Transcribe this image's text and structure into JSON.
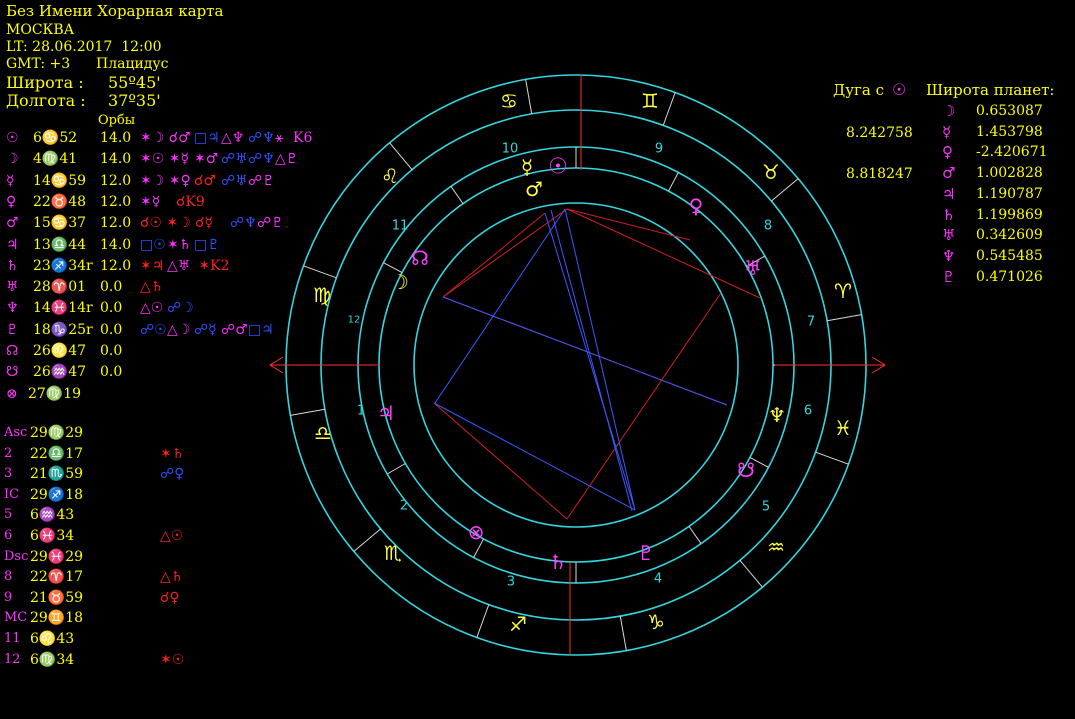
{
  "header": {
    "title": "Без Имени Хорарная карта",
    "city": "МОСКВА",
    "lt": "LT: 28.06.2017  12:00",
    "gmt": "GMT: +3",
    "system": "Плацидус",
    "lat_label": "Широта :",
    "lat_value": "55º45'",
    "lon_label": "Долгота :",
    "lon_value": "37º35'",
    "orbs_label": "Орбы"
  },
  "planets": [
    {
      "glyph": "☉",
      "pos": "6♋52",
      "orb": "14.0",
      "asp": [
        {
          "t": "✶☽ ☌♂ ",
          "c": "m"
        },
        {
          "t": "□♃ ",
          "c": "b"
        },
        {
          "t": "△♆ ",
          "c": "m"
        },
        {
          "t": "☍♆ ",
          "c": "b"
        },
        {
          "t": "⚹ ",
          "c": "m"
        },
        {
          "t": "K6",
          "c": "m"
        }
      ]
    },
    {
      "glyph": "☽",
      "pos": "4♍41",
      "orb": "14.0",
      "asp": [
        {
          "t": "✶☉ ✶☿ ",
          "c": "m"
        },
        {
          "t": "✶♂ ",
          "c": "m"
        },
        {
          "t": "☍♅ ",
          "c": "b"
        },
        {
          "t": "☍♆ ",
          "c": "b"
        },
        {
          "t": "△♇",
          "c": "m"
        }
      ]
    },
    {
      "glyph": "☿",
      "pos": "14♋59",
      "orb": "12.0",
      "asp": [
        {
          "t": "✶☽ ✶♀ ",
          "c": "m"
        },
        {
          "t": "☌♂ ",
          "c": "r"
        },
        {
          "t": "☍♅ ",
          "c": "b"
        },
        {
          "t": "☍♇",
          "c": "m"
        }
      ]
    },
    {
      "glyph": "♀",
      "pos": "22♉48",
      "orb": "12.0",
      "asp": [
        {
          "t": "✶☿  ",
          "c": "m"
        },
        {
          "t": "☌K9",
          "c": "r"
        }
      ]
    },
    {
      "glyph": "♂",
      "pos": "15♋37",
      "orb": "12.0",
      "asp": [
        {
          "t": "☌☉ ✶☽ ☌☿  ",
          "c": "r"
        },
        {
          "t": "☍♆ ",
          "c": "b"
        },
        {
          "t": "☍♇",
          "c": "m"
        }
      ]
    },
    {
      "glyph": "♃",
      "pos": "13♎44",
      "orb": "14.0",
      "asp": [
        {
          "t": "□☉ ",
          "c": "b"
        },
        {
          "t": "✶♄ ",
          "c": "m"
        },
        {
          "t": "□♇",
          "c": "b"
        }
      ]
    },
    {
      "glyph": "♄",
      "pos": "23♐34r",
      "orb": "12.0",
      "asp": [
        {
          "t": "✶♃ ",
          "c": "r"
        },
        {
          "t": "△♅ ",
          "c": "m"
        },
        {
          "t": " ✶K2",
          "c": "r"
        }
      ]
    },
    {
      "glyph": "♅",
      "pos": "28♈01",
      "orb": "0.0",
      "asp": [
        {
          "t": "△♄",
          "c": "r"
        }
      ]
    },
    {
      "glyph": "♆",
      "pos": "14♓14r",
      "orb": "0.0",
      "asp": [
        {
          "t": "△☉ ",
          "c": "m"
        },
        {
          "t": "☍☽",
          "c": "b"
        }
      ]
    },
    {
      "glyph": "♇",
      "pos": "18♑25r",
      "orb": "0.0",
      "asp": [
        {
          "t": "☍☉ ",
          "c": "b"
        },
        {
          "t": "△☽ ",
          "c": "m"
        },
        {
          "t": "☍☿ ",
          "c": "b"
        },
        {
          "t": "☍♂ ",
          "c": "m"
        },
        {
          "t": "□♃",
          "c": "b"
        }
      ]
    },
    {
      "glyph": "☊",
      "pos": "26♌47",
      "orb": "0.0",
      "asp": []
    },
    {
      "glyph": "☋",
      "pos": "26♒47",
      "orb": "0.0",
      "asp": []
    },
    {
      "glyph": "⊗",
      "pos": "27♍19",
      "orb": "",
      "asp": []
    }
  ],
  "houses": [
    {
      "label": "Asc",
      "pos": "29♍29",
      "asp": "",
      "c": "r"
    },
    {
      "label": "2",
      "pos": "22♎17",
      "asp": "✶♄",
      "c": "r"
    },
    {
      "label": "3",
      "pos": "21♏59",
      "asp": "☍♀",
      "c": "b"
    },
    {
      "label": "IC",
      "pos": "29♐18",
      "asp": "",
      "c": "r"
    },
    {
      "label": "5",
      "pos": "6♒43",
      "asp": "",
      "c": "r"
    },
    {
      "label": "6",
      "pos": "6♓34",
      "asp": "△☉",
      "c": "r"
    },
    {
      "label": "Dsc",
      "pos": "29♓29",
      "asp": "",
      "c": "r"
    },
    {
      "label": "8",
      "pos": "22♈17",
      "asp": "△♄",
      "c": "r"
    },
    {
      "label": "9",
      "pos": "21♉59",
      "asp": "☌♀",
      "c": "r"
    },
    {
      "label": "MC",
      "pos": "29♊18",
      "asp": "",
      "c": "r"
    },
    {
      "label": "11",
      "pos": "6♌43",
      "asp": "",
      "c": "r"
    },
    {
      "label": "12",
      "pos": "6♍34",
      "asp": "✶☉",
      "c": "r"
    }
  ],
  "arc": {
    "title": "Дуга с",
    "title_glyph": "☉",
    "values": [
      "8.242758",
      "8.818247"
    ]
  },
  "latitudes": {
    "title": "Широта планет:",
    "rows": [
      {
        "glyph": "☽",
        "value": "0.653087"
      },
      {
        "glyph": "☿",
        "value": "1.453798"
      },
      {
        "glyph": "♀",
        "value": "-2.420671"
      },
      {
        "glyph": "♂",
        "value": "1.002828"
      },
      {
        "glyph": "♃",
        "value": "1.190787"
      },
      {
        "glyph": "♄",
        "value": "1.199869"
      },
      {
        "glyph": "♅",
        "value": "0.342609"
      },
      {
        "glyph": "♆",
        "value": "0.545485"
      },
      {
        "glyph": "♇",
        "value": "0.471026"
      }
    ]
  },
  "wheel": {
    "signs": [
      "♈",
      "♉",
      "♊",
      "♋",
      "♌",
      "♍",
      "♎",
      "♏",
      "♐",
      "♑",
      "♒",
      "♓"
    ],
    "house_numbers": [
      "1",
      "2",
      "3",
      "4",
      "5",
      "6",
      "7",
      "8",
      "9",
      "10",
      "11",
      "12"
    ],
    "planet_glyphs": [
      "☉",
      "☽",
      "☿",
      "♀",
      "♂",
      "♃",
      "♄",
      "♅",
      "♆",
      "♇",
      "☊",
      "☋",
      "⊗"
    ]
  }
}
